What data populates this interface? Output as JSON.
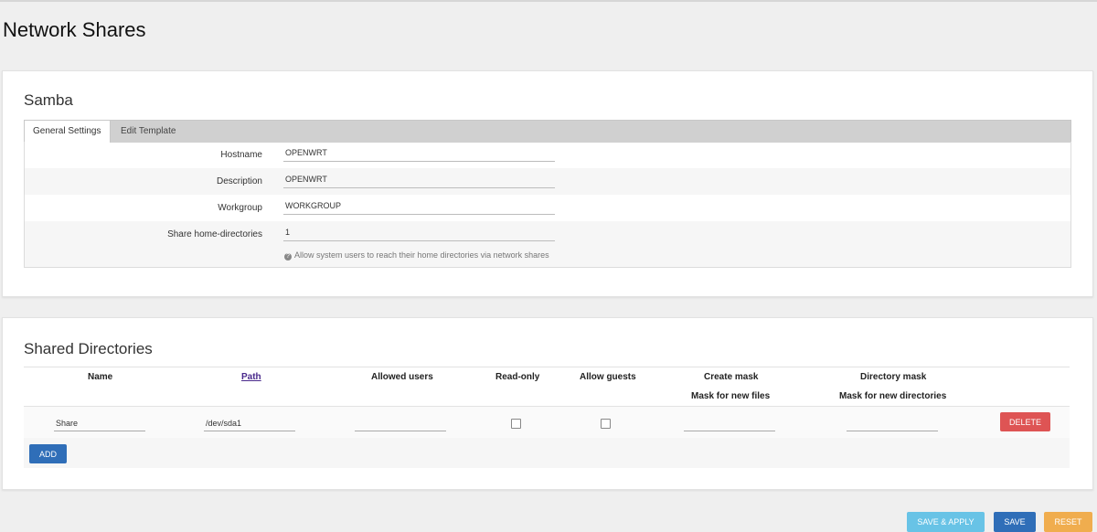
{
  "page": {
    "title": "Network Shares"
  },
  "samba": {
    "title": "Samba",
    "tabs": [
      {
        "label": "General Settings",
        "active": true
      },
      {
        "label": "Edit Template",
        "active": false
      }
    ],
    "fields": [
      {
        "label": "Hostname",
        "value": "OPENWRT"
      },
      {
        "label": "Description",
        "value": "OPENWRT"
      },
      {
        "label": "Workgroup",
        "value": "WORKGROUP"
      },
      {
        "label": "Share home-directories",
        "value": "1"
      }
    ],
    "help_text": "Allow system users to reach their home directories via network shares",
    "help_icon": "?"
  },
  "shared": {
    "title": "Shared Directories",
    "columns": {
      "name": "Name",
      "path": "Path",
      "allowed_users": "Allowed users",
      "read_only": "Read-only",
      "allow_guests": "Allow guests",
      "create_mask": "Create mask",
      "create_mask_sub": "Mask for new files",
      "dir_mask": "Directory mask",
      "dir_mask_sub": "Mask for new directories"
    },
    "rows": [
      {
        "name": "Share",
        "path": "/dev/sda1",
        "allowed_users": "",
        "read_only": false,
        "allow_guests": false,
        "create_mask": "",
        "dir_mask": "",
        "delete_label": "DELETE"
      }
    ],
    "add_label": "ADD"
  },
  "footer": {
    "save_apply_label": "SAVE & APPLY",
    "save_label": "SAVE",
    "reset_label": "RESET"
  },
  "colors": {
    "primary": "#2f6eb8",
    "danger": "#de5454",
    "info": "#68c3e6",
    "warning": "#f0ad4e"
  }
}
